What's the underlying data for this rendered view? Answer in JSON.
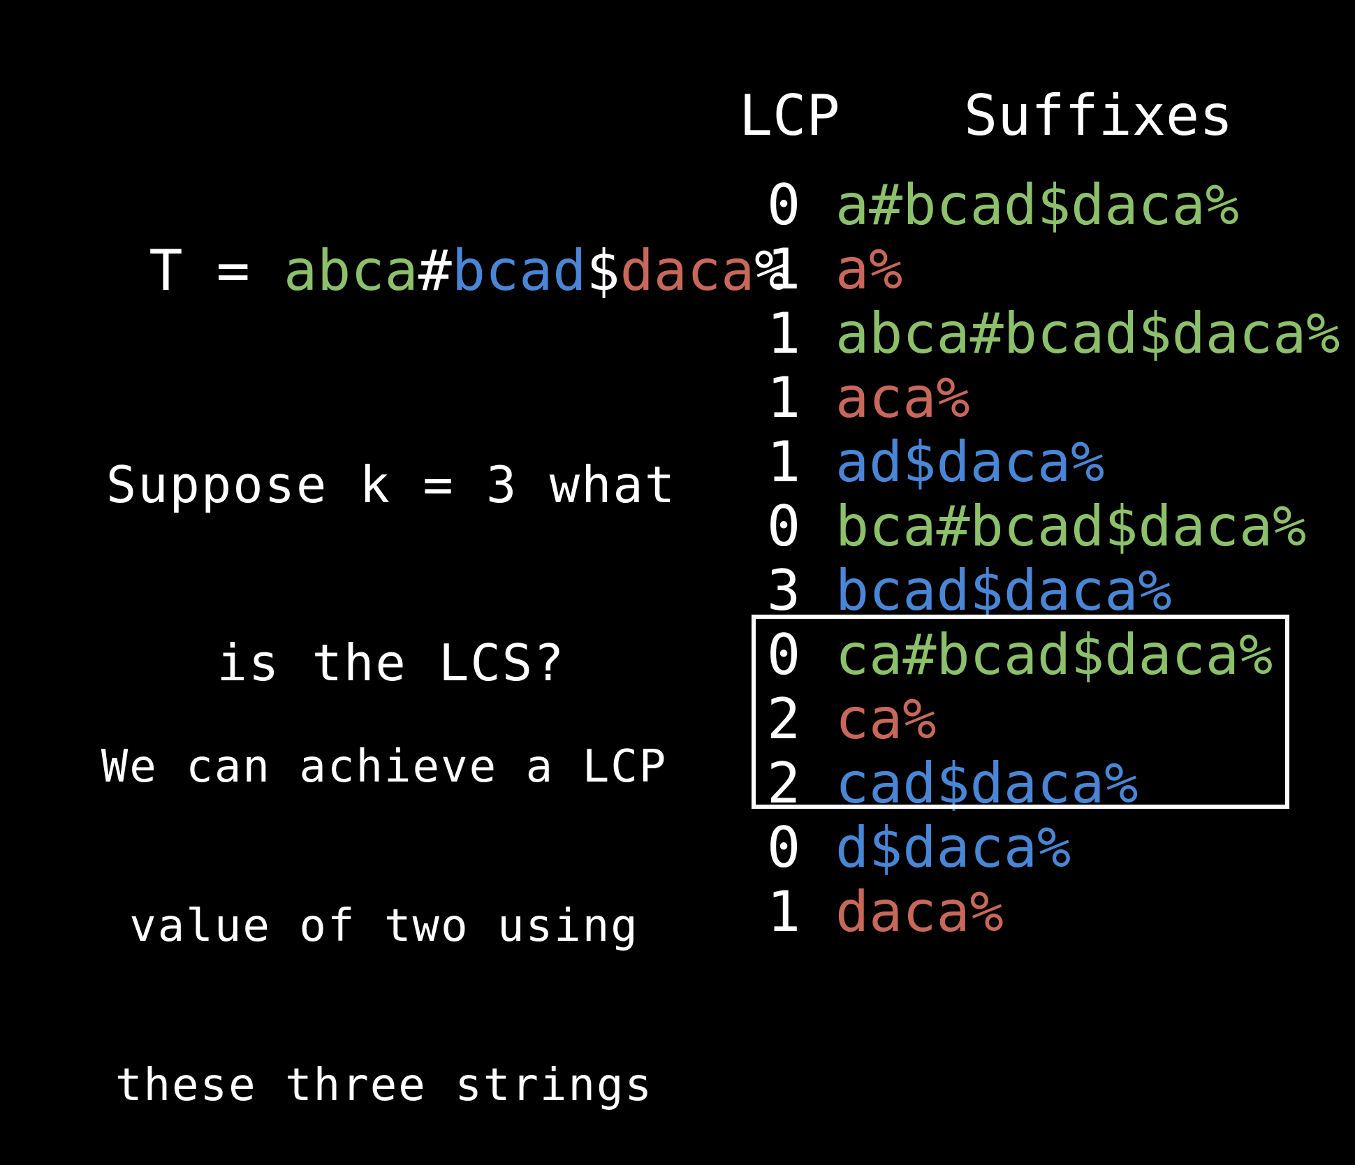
{
  "colors": {
    "background": "#000000",
    "text": "#ffffff",
    "string1": "#8cc06b",
    "string2": "#4a86d6",
    "string3": "#c8685a"
  },
  "header": {
    "lcp_label": "LCP",
    "suffixes_label": "Suffixes"
  },
  "text_string": {
    "prefix": "T = ",
    "parts": [
      {
        "text": "abca",
        "color": "string1"
      },
      {
        "text": "#",
        "color": "text"
      },
      {
        "text": "bcad",
        "color": "string2"
      },
      {
        "text": "$",
        "color": "text"
      },
      {
        "text": "daca",
        "color": "string3"
      },
      {
        "text": "%",
        "color": "text"
      }
    ]
  },
  "question": {
    "line1": "Suppose k = 3 what",
    "line2": "is the LCS?"
  },
  "explanation": {
    "line1": "We can achieve a LCP",
    "line2": "value of two using",
    "line3": "these three strings"
  },
  "rows": [
    {
      "lcp": "0",
      "suffix": "a#bcad$daca%",
      "color": "string1"
    },
    {
      "lcp": "1",
      "suffix": "a%",
      "color": "string3"
    },
    {
      "lcp": "1",
      "suffix": "abca#bcad$daca%",
      "color": "string1"
    },
    {
      "lcp": "1",
      "suffix": "aca%",
      "color": "string3"
    },
    {
      "lcp": "1",
      "suffix": "ad$daca%",
      "color": "string2"
    },
    {
      "lcp": "0",
      "suffix": "bca#bcad$daca%",
      "color": "string1"
    },
    {
      "lcp": "3",
      "suffix": "bcad$daca%",
      "color": "string2"
    },
    {
      "lcp": "0",
      "suffix": "ca#bcad$daca%",
      "color": "string1"
    },
    {
      "lcp": "2",
      "suffix": "ca%",
      "color": "string3"
    },
    {
      "lcp": "2",
      "suffix": "cad$daca%",
      "color": "string2"
    },
    {
      "lcp": "0",
      "suffix": "d$daca%",
      "color": "string2"
    },
    {
      "lcp": "1",
      "suffix": "daca%",
      "color": "string3"
    }
  ],
  "highlight": {
    "from_row": 7,
    "to_row": 9
  }
}
